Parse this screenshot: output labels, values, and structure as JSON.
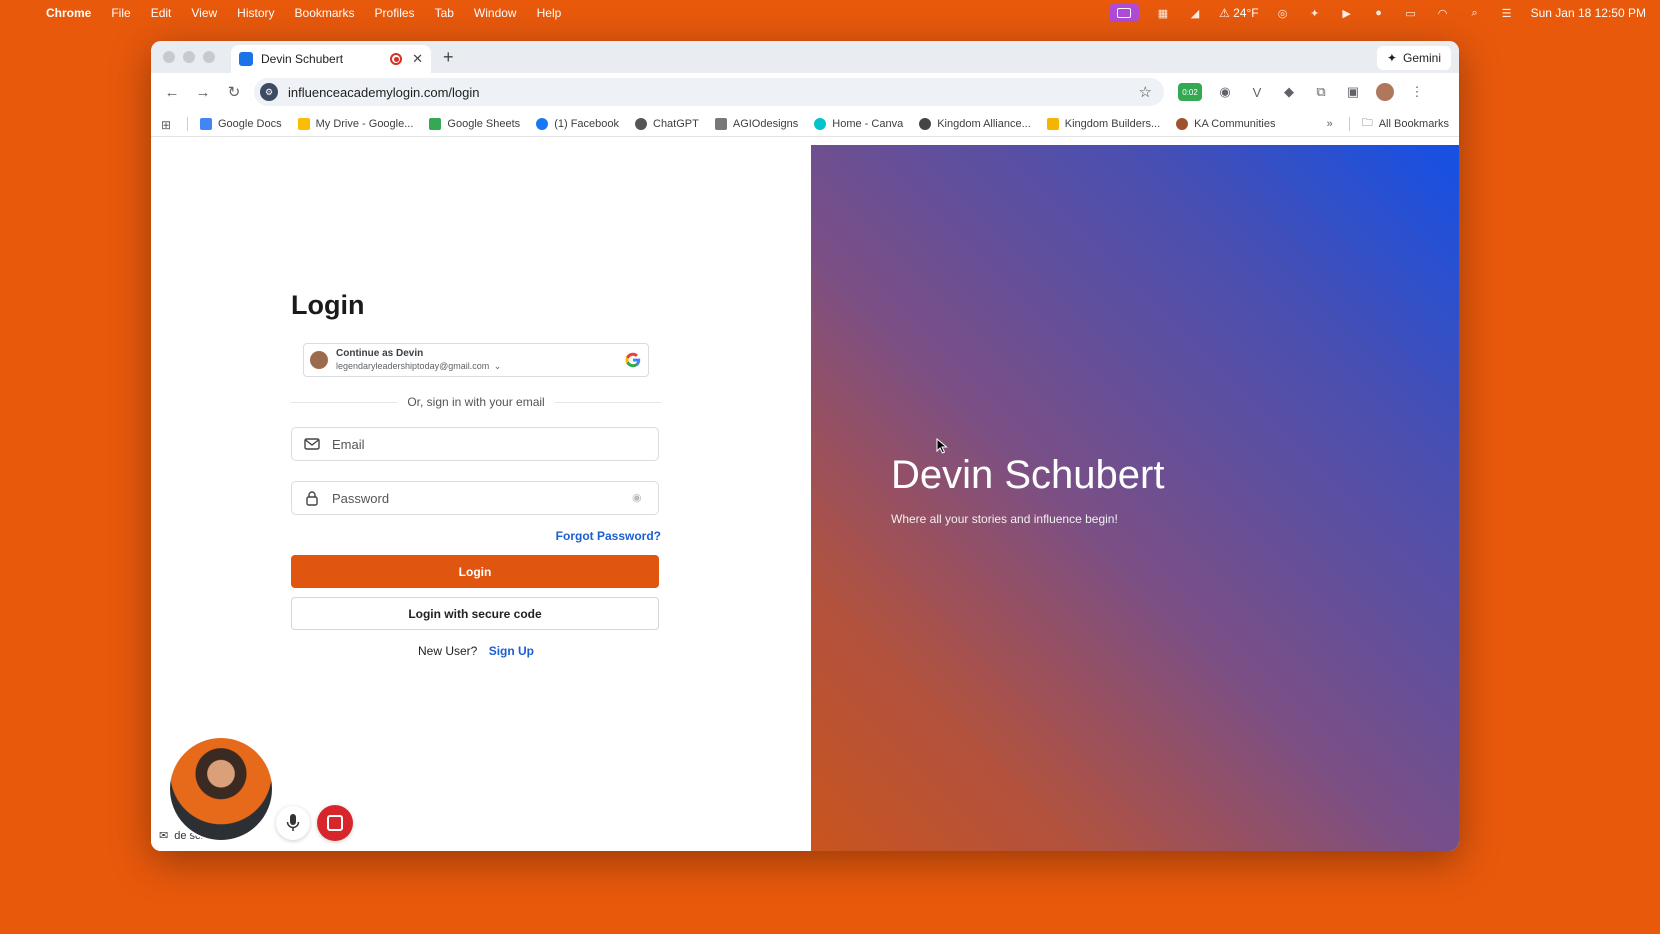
{
  "menubar": {
    "app": "Chrome",
    "items": [
      "File",
      "Edit",
      "View",
      "History",
      "Bookmarks",
      "Profiles",
      "Tab",
      "Window",
      "Help"
    ],
    "weather": "24°F",
    "datetime": "Sun Jan 18  12:50 PM"
  },
  "browser": {
    "tab_title": "Devin Schubert",
    "gemini_label": "Gemini",
    "url": "influenceacademylogin.com/login",
    "timer_badge": "0:02",
    "bookmarks": [
      {
        "label": "Google Docs",
        "color": "#4285f4"
      },
      {
        "label": "My Drive - Google...",
        "color": "#fbbc04"
      },
      {
        "label": "Google Sheets",
        "color": "#34a853"
      },
      {
        "label": "(1) Facebook",
        "color": "#1877f2"
      },
      {
        "label": "ChatGPT",
        "color": "#555555"
      },
      {
        "label": "AGIOdesigns",
        "color": "#777777"
      },
      {
        "label": "Home - Canva",
        "color": "#00c4cc"
      },
      {
        "label": "Kingdom Alliance...",
        "color": "#444444"
      },
      {
        "label": "Kingdom Builders...",
        "color": "#f4b400"
      },
      {
        "label": "KA Communities",
        "color": "#a0522d"
      }
    ],
    "all_bookmarks": "All Bookmarks"
  },
  "login": {
    "title": "Login",
    "google": {
      "name": "Continue as Devin",
      "email": "legendaryleadershiptoday@gmail.com"
    },
    "divider": "Or, sign in with your email",
    "email_placeholder": "Email",
    "password_placeholder": "Password",
    "forgot": "Forgot Password?",
    "login_button": "Login",
    "secure_code_button": "Login with secure code",
    "new_user": "New User?",
    "sign_up": "Sign Up"
  },
  "brand": {
    "name": "Devin Schubert",
    "tagline": "Where all your stories and influence begin!"
  },
  "recorder": {
    "status_text": "de          schub"
  },
  "colors": {
    "desktop": "#e8590c",
    "primary_button": "#e0550f",
    "link": "#1b5fd1"
  }
}
